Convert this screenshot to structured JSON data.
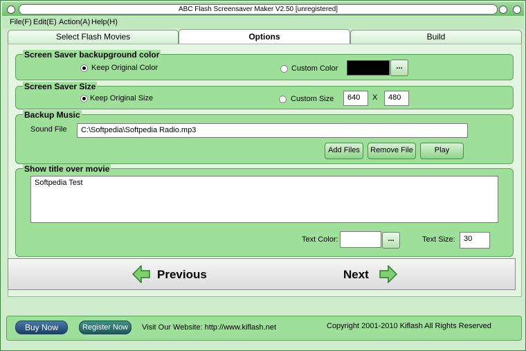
{
  "window": {
    "title": "ABC Flash Screensaver Maker V2.50 [unregistered]"
  },
  "menu": [
    "File(F)",
    "Edit(E)",
    "Action(A)",
    "Help(H)"
  ],
  "tabs": [
    "Select Flash Movies",
    "Options",
    "Build"
  ],
  "active_tab": "Options",
  "bgcolor": {
    "title": "Screen Saver backupground color",
    "keep_label": "Keep Original Color",
    "custom_label": "Custom Color",
    "swatch": "#000000",
    "browse_label": "..."
  },
  "size": {
    "title": "Screen Saver Size",
    "keep_label": "Keep Original Size",
    "custom_label": "Custom Size",
    "width": "640",
    "x_label": "X",
    "height": "480"
  },
  "music": {
    "title": "Backup Music",
    "sound_label": "Sound File",
    "sound_value": "C:\\Softpedia\\Softpedia Radio.mp3",
    "add_label": "Add Files",
    "remove_label": "Remove File",
    "play_label": "Play"
  },
  "movie_title": {
    "title": "Show title over movie",
    "text": "Softpedia Test",
    "color_label": "Text Color:",
    "color_browse": "...",
    "size_label": "Text Size:",
    "size_value": "30"
  },
  "nav": {
    "previous_label": "Previous",
    "next_label": "Next"
  },
  "footer": {
    "buy_label": "Buy Now",
    "register_label": "Register Now",
    "website_text": "Visit Our Website: http://www.kiflash.net",
    "copyright": "Copyright 2001-2010 Kiflash All Rights Reserved"
  }
}
